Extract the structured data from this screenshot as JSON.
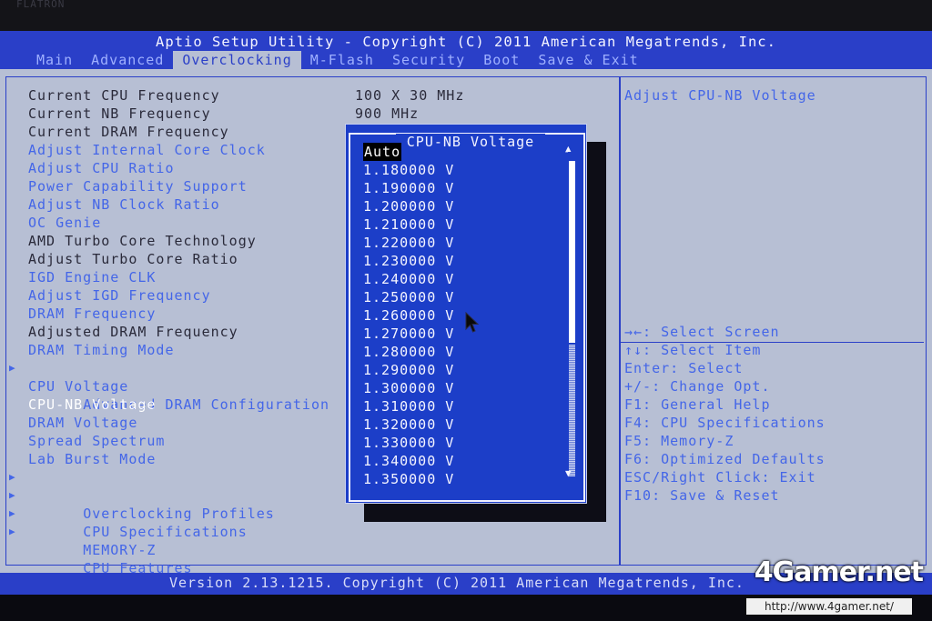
{
  "bezel": {
    "brand": "FLATRON"
  },
  "header": {
    "title": "Aptio Setup Utility - Copyright (C) 2011 American Megatrends, Inc.",
    "tabs": [
      {
        "label": "Main",
        "active": false
      },
      {
        "label": "Advanced",
        "active": false
      },
      {
        "label": "Overclocking",
        "active": true
      },
      {
        "label": "M-Flash",
        "active": false
      },
      {
        "label": "Security",
        "active": false
      },
      {
        "label": "Boot",
        "active": false
      },
      {
        "label": "Save & Exit",
        "active": false
      }
    ]
  },
  "menu": {
    "items": [
      {
        "label": "Current CPU Frequency",
        "value": "100 X 30 MHz",
        "type": "static"
      },
      {
        "label": "Current NB Frequency",
        "value": "900 MHz",
        "type": "static"
      },
      {
        "label": "Current DRAM Frequency",
        "value": "",
        "type": "static"
      },
      {
        "label": "Adjust Internal Core Clock",
        "type": "option"
      },
      {
        "label": "Adjust CPU Ratio",
        "type": "option"
      },
      {
        "label": "Power Capability Support",
        "type": "option"
      },
      {
        "label": "Adjust NB Clock Ratio",
        "type": "option"
      },
      {
        "label": "OC Genie",
        "type": "option"
      },
      {
        "label": "AMD Turbo Core Technology",
        "type": "static"
      },
      {
        "label": "Adjust Turbo Core Ratio",
        "type": "static"
      },
      {
        "label": "IGD Engine CLK",
        "type": "option"
      },
      {
        "label": "Adjust IGD Frequency",
        "type": "option"
      },
      {
        "label": "DRAM Frequency",
        "type": "option"
      },
      {
        "label": "Adjusted DRAM Frequency",
        "type": "static"
      },
      {
        "label": "DRAM Timing Mode",
        "type": "option"
      },
      {
        "label": "Advanced DRAM Configuration",
        "type": "submenu"
      },
      {
        "label": "CPU Voltage",
        "type": "option"
      },
      {
        "label": "CPU-NB Voltage",
        "type": "selected"
      },
      {
        "label": "DRAM Voltage",
        "type": "option"
      },
      {
        "label": "Spread Spectrum",
        "type": "option"
      },
      {
        "label": "Lab Burst Mode",
        "type": "option"
      },
      {
        "label": "Overclocking Profiles",
        "type": "submenu"
      },
      {
        "label": "CPU Specifications",
        "type": "submenu"
      },
      {
        "label": "MEMORY-Z",
        "type": "submenu"
      },
      {
        "label": "CPU Features",
        "type": "submenu"
      }
    ],
    "submenu_arrow": "▶"
  },
  "popup": {
    "title": "CPU-NB Voltage",
    "options": [
      "Auto",
      "1.180000 V",
      "1.190000 V",
      "1.200000 V",
      "1.210000 V",
      "1.220000 V",
      "1.230000 V",
      "1.240000 V",
      "1.250000 V",
      "1.260000 V",
      "1.270000 V",
      "1.280000 V",
      "1.290000 V",
      "1.300000 V",
      "1.310000 V",
      "1.320000 V",
      "1.330000 V",
      "1.340000 V",
      "1.350000 V"
    ],
    "selected_index": 0,
    "scroll_up_glyph": "▲",
    "scroll_down_glyph": "▼"
  },
  "help": {
    "description": "Adjust CPU-NB Voltage",
    "keys": [
      "→←: Select Screen",
      "↑↓: Select Item",
      "Enter: Select",
      "+/-: Change Opt.",
      "F1: General Help",
      "F4: CPU Specifications",
      "F5: Memory-Z",
      "F6: Optimized Defaults",
      "ESC/Right Click: Exit",
      "F10: Save & Reset"
    ]
  },
  "footer": {
    "text": "Version 2.13.1215. Copyright (C) 2011 American Megatrends, Inc."
  },
  "watermark": {
    "logo": "4Gamer.net",
    "url": "http://www.4gamer.net/"
  },
  "colors": {
    "bar_blue": "#2a3fc8",
    "option_blue": "#4466e8",
    "panel_gray": "#b7bfd4",
    "popup_blue": "#1c3ec8"
  },
  "icons": {
    "cursor": "mouse-pointer-icon"
  }
}
